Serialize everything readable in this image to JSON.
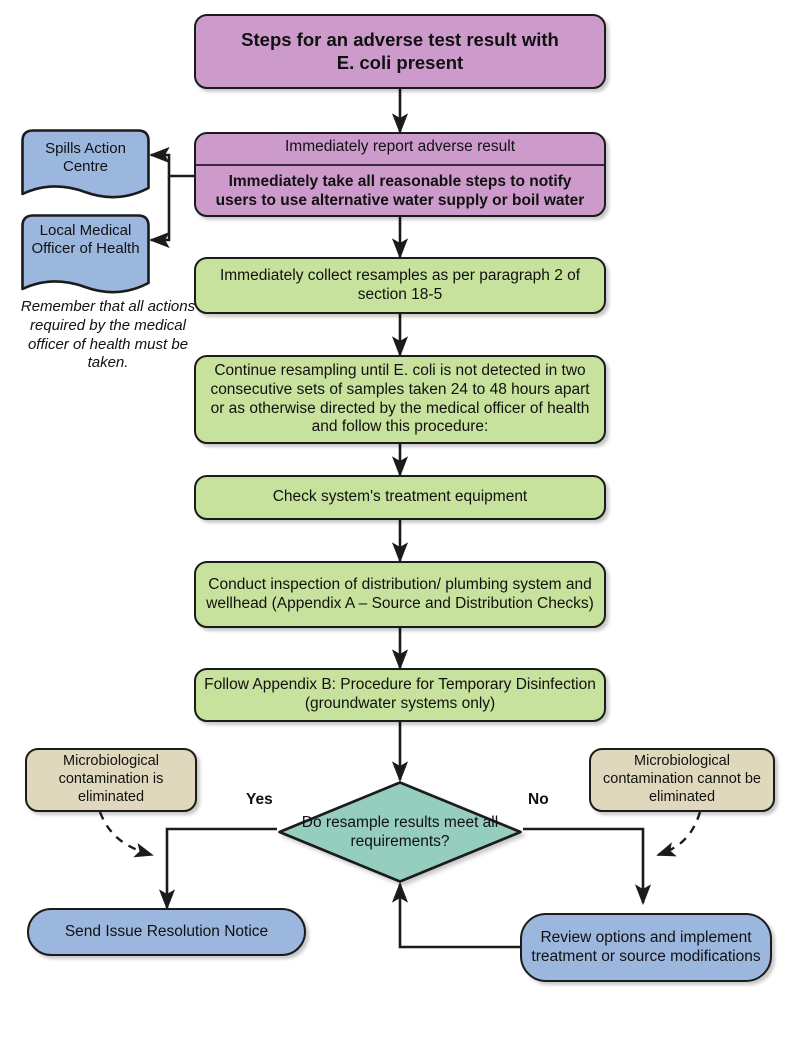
{
  "diagram": {
    "title": "Steps for an adverse test result with E. coli present",
    "nodes": {
      "title_box": {
        "label": "Steps for an adverse test result with\nE. coli present",
        "color": "#CC9BCB",
        "shape": "rounded-rectangle"
      },
      "report_box": {
        "line1": "Immediately report adverse result",
        "line2": "Immediately take all reasonable steps to notify users to use alternative water supply or boil water",
        "color": "#CC9BCB",
        "shape": "rounded-rectangle-split"
      },
      "spills_action_centre": {
        "label": "Spills Action Centre",
        "color": "#9BB7DE",
        "shape": "document"
      },
      "local_medical_officer": {
        "label": "Local Medical Officer of Health",
        "color": "#9BB7DE",
        "shape": "document"
      },
      "note": {
        "label": "Remember that all actions required by the medical officer of health must be taken.",
        "style": "italic"
      },
      "collect_resamples": {
        "label": "Immediately collect resamples as per paragraph 2 of section 18-5",
        "color": "#C7E29C",
        "shape": "rounded-rectangle"
      },
      "continue_resampling": {
        "label": "Continue resampling until E. coli is not detected in two consecutive sets of samples taken 24 to 48 hours apart or as otherwise directed by the medical officer of health and follow this procedure:",
        "color": "#C7E29C",
        "shape": "rounded-rectangle"
      },
      "check_treatment": {
        "label": "Check system's treatment equipment",
        "color": "#C7E29C",
        "shape": "rounded-rectangle"
      },
      "conduct_inspection": {
        "label": "Conduct inspection of distribution/ plumbing system and wellhead (Appendix A – Source and Distribution Checks)",
        "color": "#C7E29C",
        "shape": "rounded-rectangle"
      },
      "follow_appendix_b": {
        "label": "Follow Appendix B: Procedure for Temporary Disinfection (groundwater systems only)",
        "color": "#C7E29C",
        "shape": "rounded-rectangle"
      },
      "contamination_eliminated": {
        "label": "Microbiological contamination is eliminated",
        "color": "#E0D8BC",
        "shape": "rounded-rectangle"
      },
      "contamination_not_eliminated": {
        "label": "Microbiological contamination cannot be eliminated",
        "color": "#E0D8BC",
        "shape": "rounded-rectangle"
      },
      "decision": {
        "label": "Do resample results meet all requirements?",
        "color": "#95CDBF",
        "shape": "diamond"
      },
      "send_notice": {
        "label": "Send Issue Resolution Notice",
        "color": "#9BB7DE",
        "shape": "pill"
      },
      "review_options": {
        "label": "Review options and implement treatment or source modifications",
        "color": "#9BB7DE",
        "shape": "rounded-rectangle"
      }
    },
    "edge_labels": {
      "yes": "Yes",
      "no": "No"
    },
    "colors": {
      "purple": "#CC9BCB",
      "green": "#C7E29C",
      "blue": "#9BB7DE",
      "beige": "#E0D8BC",
      "teal": "#95CDBF",
      "outline": "#1b1b1b",
      "background": "#ffffff"
    }
  }
}
